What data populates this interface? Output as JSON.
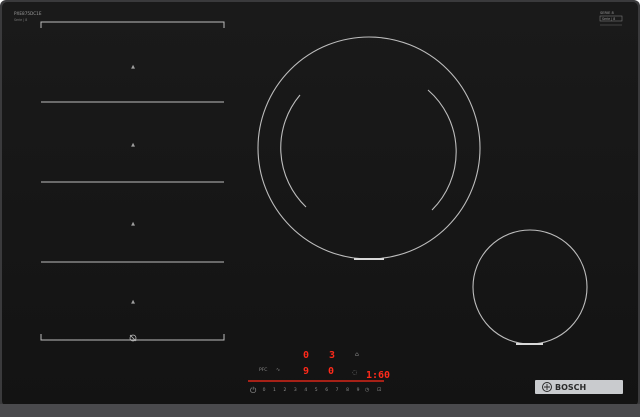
{
  "product": {
    "model_line1": "PXE875DC1E",
    "model_line2": "Serie | 8",
    "series_top": "SERIE 8",
    "series_bottom": "Serie | 8",
    "brand": "BOSCH",
    "power_symbol": "⏻"
  },
  "colors": {
    "glass": "#161616",
    "glass_edge": "#0b0b0b",
    "frame": "#3a3a3c",
    "zone_line": "#bdbdbd",
    "led_red": "#ff2a1a",
    "control_grey": "#8a8a8a",
    "badge_bg": "#c9cbce",
    "badge_text": "#2a2a2a"
  },
  "flex_zone": {
    "sections": 4,
    "symbols": [
      "▲",
      "▲",
      "▲",
      "▲"
    ]
  },
  "control_panel": {
    "left_display": "0",
    "left_sub_display": "9",
    "left_indicator": "0",
    "mid_display": "3",
    "mid_sub_display": "0",
    "timer_display": "1:60",
    "touch_scale": [
      "0",
      "1",
      "2",
      "3",
      "4",
      "5",
      "6",
      "7",
      "8",
      "9"
    ],
    "aux_icons": [
      "timer-icon",
      "pan-icon",
      "lock-icon"
    ]
  }
}
